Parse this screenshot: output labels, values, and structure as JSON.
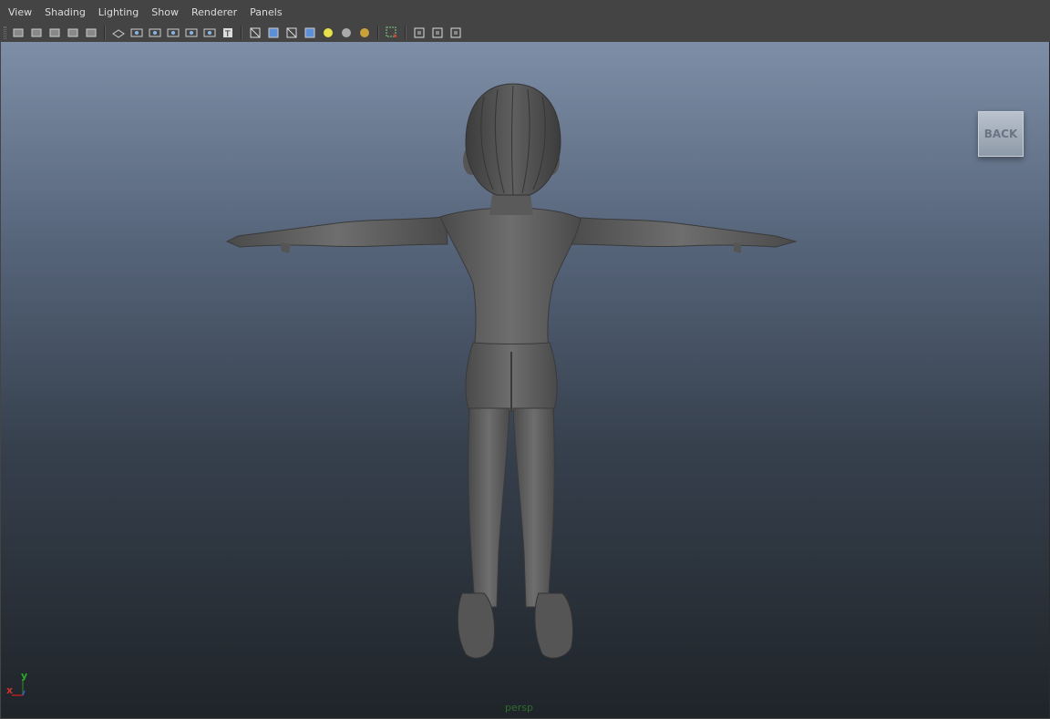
{
  "menu": [
    "View",
    "Shading",
    "Lighting",
    "Show",
    "Renderer",
    "Panels"
  ],
  "toolbar_icons": [
    "select-camera-icon",
    "camera-attributes-icon",
    "bookmarks-icon",
    "image-plane-icon",
    "grease-pencil-icon",
    "grid-icon",
    "film-gate-icon",
    "resolution-gate-icon",
    "gate-mask-icon",
    "field-chart-icon",
    "safe-action-icon",
    "safe-title-icon",
    "wireframe-icon",
    "smooth-shade-icon",
    "wireframe-on-shaded-icon",
    "textured-icon",
    "use-all-lights-icon",
    "shadows-icon",
    "ambient-occlusion-icon",
    "isolate-select-icon",
    "xray-icon",
    "xray-joints-icon",
    "xray-components-icon"
  ],
  "viewcube": {
    "label": "BACK"
  },
  "camera": {
    "name": "persp"
  },
  "axis": {
    "x": "x",
    "y": "y"
  }
}
